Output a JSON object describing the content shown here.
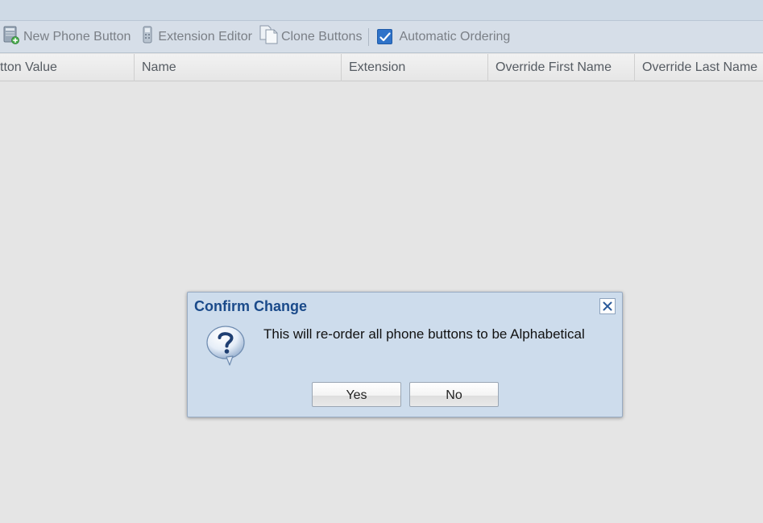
{
  "toolbar": {
    "new_phone_button": {
      "label": "New Phone Button",
      "icon": "phone-add-icon"
    },
    "extension_editor": {
      "label": "Extension Editor",
      "icon": "handset-icon"
    },
    "clone_buttons": {
      "label": "Clone Buttons",
      "icon": "clone-icon"
    },
    "automatic_ordering": {
      "label": "Automatic Ordering",
      "checked": true
    }
  },
  "grid": {
    "columns": [
      "tton Value",
      "Name",
      "Extension",
      "Override First Name",
      "Override Last Name"
    ]
  },
  "dialog": {
    "title": "Confirm Change",
    "message": "This will re-order all phone buttons to be Alphabetical",
    "icon": "question-icon",
    "yes_label": "Yes",
    "no_label": "No"
  },
  "colors": {
    "checkbox": "#2f73c9",
    "dialog_title": "#1a4a8a",
    "dialog_bg": "#cddcec"
  }
}
